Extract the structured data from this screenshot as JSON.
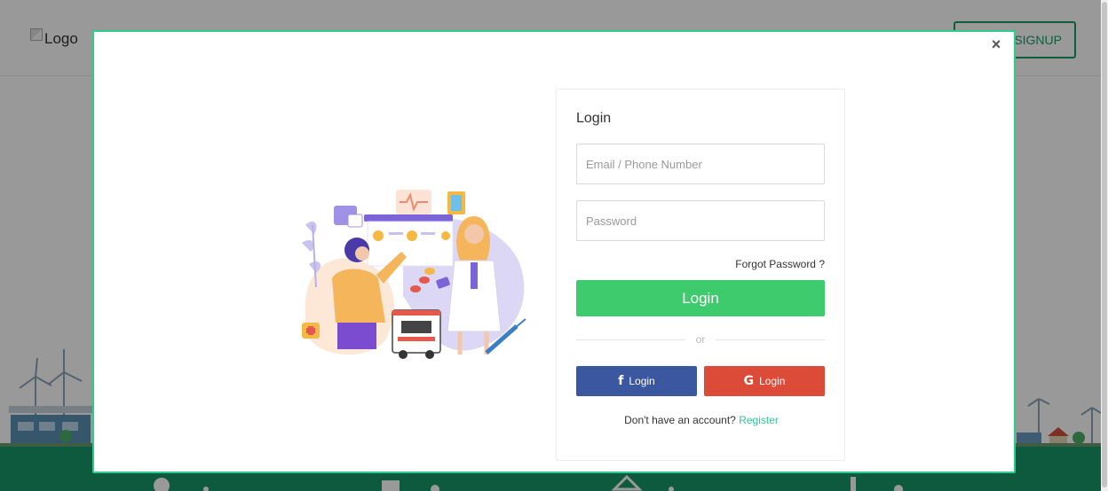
{
  "background": {
    "logo_alt": "Logo",
    "signup_label": "SIGNUP"
  },
  "modal": {
    "close_symbol": "×",
    "login": {
      "title": "Login",
      "email_placeholder": "Email / Phone Number",
      "email_value": "",
      "password_placeholder": "Password",
      "password_value": "",
      "forgot_label": "Forgot Password ?",
      "submit_label": "Login",
      "divider_text": "or",
      "facebook": {
        "icon": "facebook-icon",
        "glyph": "f",
        "label": "Login"
      },
      "google": {
        "icon": "google-icon",
        "glyph": "G",
        "label": "Login"
      },
      "register_prompt": "Don't have an account?",
      "register_link": "Register"
    }
  },
  "colors": {
    "accent_green": "#3dcb6e",
    "modal_border": "#2ecc8e",
    "facebook": "#3b57a0",
    "google": "#dc4a38",
    "link": "#2ec49a",
    "footer": "#17966a"
  }
}
